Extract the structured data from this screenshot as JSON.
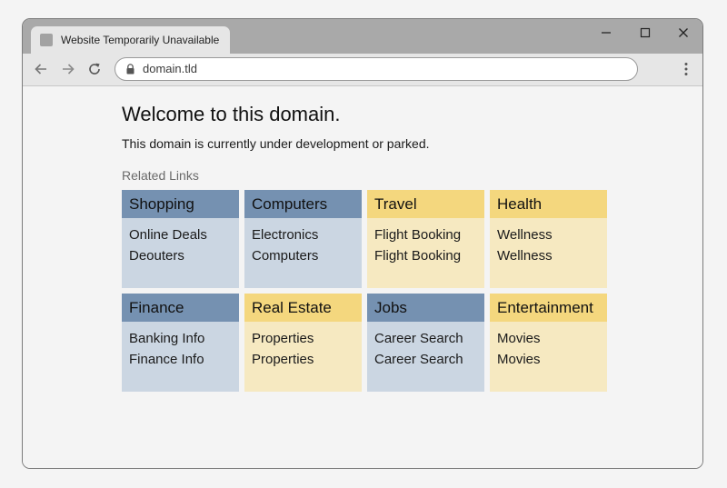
{
  "browser": {
    "tab_title": "Website Temporarily Unavailable",
    "url": "domain.tld",
    "icons": {
      "favicon": "favicon-icon",
      "back": "back-arrow-icon",
      "forward": "forward-arrow-icon",
      "reload": "reload-icon",
      "lock": "lock-icon",
      "menu": "more-vertical-icon",
      "minimize": "minimize-icon",
      "maximize": "maximize-icon",
      "close": "close-icon"
    }
  },
  "page": {
    "heading": "Welcome to this domain.",
    "subtitle": "This domain is currently under development or parked.",
    "related_label": "Related Links"
  },
  "colors": {
    "blue_header": "#7591b1",
    "blue_body": "#cbd6e2",
    "yellow_header": "#f4d77e",
    "yellow_body": "#f6e9c1"
  },
  "categories": [
    {
      "title": "Shopping",
      "theme": "blue",
      "links": [
        "Online Deals",
        "Deouters"
      ]
    },
    {
      "title": "Computers",
      "theme": "blue",
      "links": [
        "Electronics",
        "Computers"
      ]
    },
    {
      "title": "Travel",
      "theme": "yellow",
      "links": [
        "Flight Booking",
        "Flight Booking"
      ]
    },
    {
      "title": "Health",
      "theme": "yellow",
      "links": [
        "Wellness",
        "Wellness"
      ]
    },
    {
      "title": "Finance",
      "theme": "blue",
      "links": [
        "Banking Info",
        "Finance Info"
      ]
    },
    {
      "title": "Real Estate",
      "theme": "yellow",
      "links": [
        "Properties",
        "Properties"
      ]
    },
    {
      "title": "Jobs",
      "theme": "blue",
      "links": [
        "Career Search",
        "Career Search"
      ]
    },
    {
      "title": "Entertainment",
      "theme": "yellow",
      "links": [
        "Movies",
        "Movies"
      ]
    }
  ]
}
